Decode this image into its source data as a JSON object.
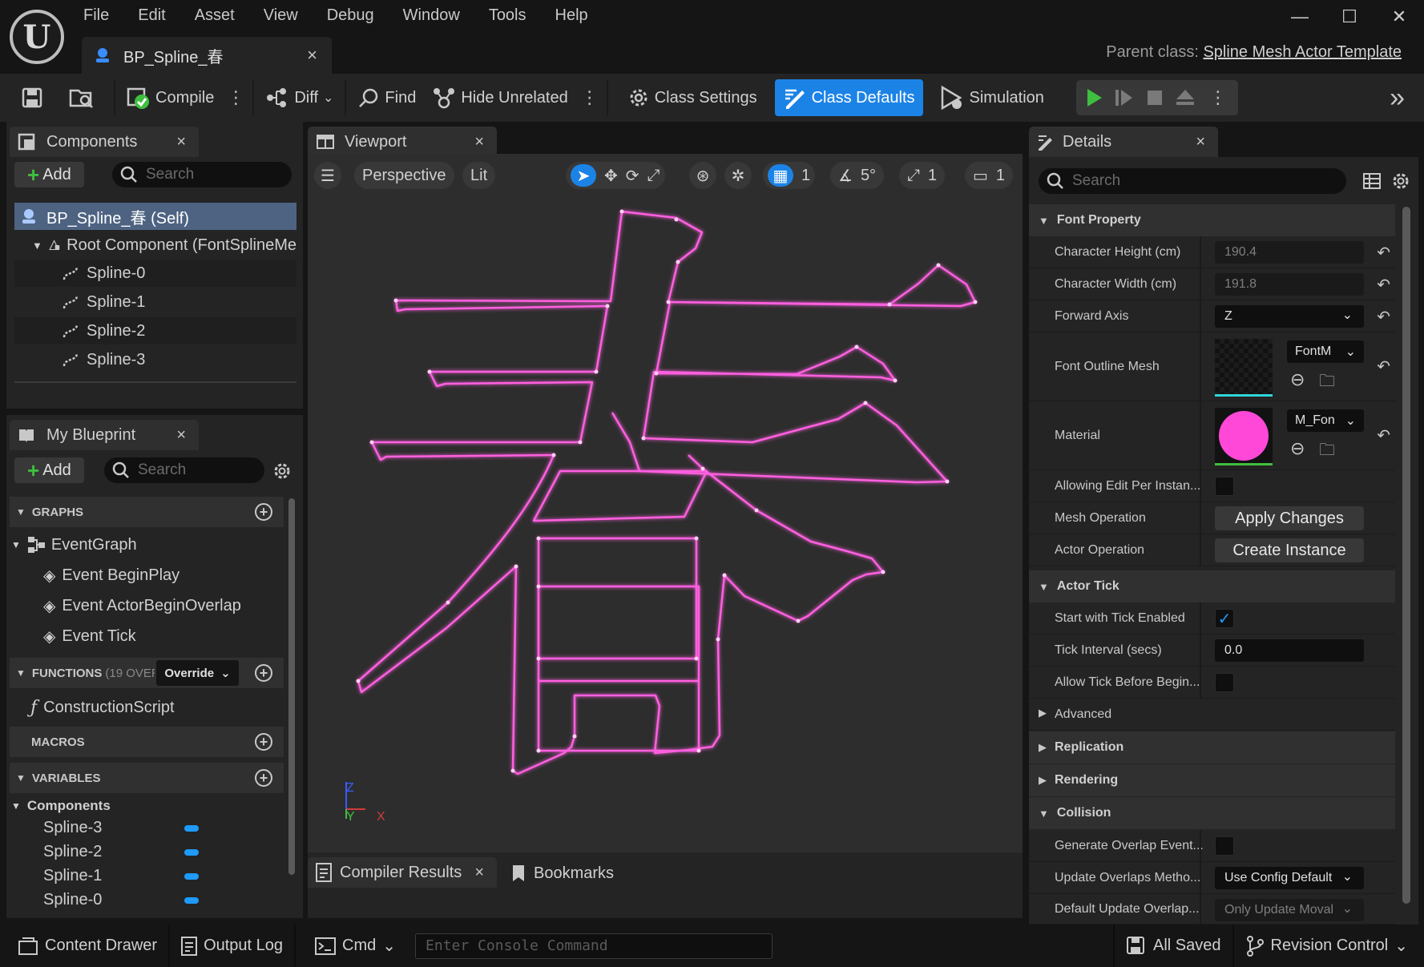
{
  "app": {
    "logo": "U"
  },
  "menu": [
    "File",
    "Edit",
    "Asset",
    "View",
    "Debug",
    "Window",
    "Tools",
    "Help"
  ],
  "document_tab": {
    "title": "BP_Spline_春",
    "close": "×"
  },
  "window_controls": {
    "minimize": "—",
    "maximize": "☐",
    "close": "✕"
  },
  "parent_class": {
    "label": "Parent class:",
    "value": "Spline Mesh Actor Template"
  },
  "toolbar": {
    "compile": "Compile",
    "diff": "Diff",
    "find": "Find",
    "hide_unrelated": "Hide Unrelated",
    "class_settings": "Class Settings",
    "class_defaults": "Class Defaults",
    "simulation": "Simulation",
    "overflow": "»"
  },
  "components_panel": {
    "tab": "Components",
    "add": "Add",
    "search_placeholder": "Search",
    "items": [
      {
        "label": "BP_Spline_春 (Self)"
      },
      {
        "label": "Root Component (FontSplineMe"
      },
      {
        "label": "Spline-0"
      },
      {
        "label": "Spline-1"
      },
      {
        "label": "Spline-2"
      },
      {
        "label": "Spline-3"
      }
    ]
  },
  "my_blueprint": {
    "tab": "My Blueprint",
    "add": "Add",
    "search_placeholder": "Search",
    "graphs_header": "GRAPHS",
    "event_graph": "EventGraph",
    "events": [
      "Event BeginPlay",
      "Event ActorBeginOverlap",
      "Event Tick"
    ],
    "functions_header": "FUNCTIONS",
    "functions_count": "(19 OVER",
    "override": "Override",
    "construction_script": "ConstructionScript",
    "macros_header": "MACROS",
    "variables_header": "VARIABLES",
    "components_group": "Components",
    "variables": [
      "Spline-3",
      "Spline-2",
      "Spline-1",
      "Spline-0"
    ],
    "variable_color": "#1e9bff"
  },
  "viewport": {
    "tab": "Viewport",
    "perspective": "Perspective",
    "lit": "Lit",
    "grid_value": "1",
    "angle_value": "5°",
    "scale_value": "1",
    "camera_value": "1",
    "spline_color": "#ff5fe0",
    "axis": {
      "z": "Z",
      "y": "Y",
      "x": "X"
    }
  },
  "bottom_tabs": {
    "compiler_results": "Compiler Results",
    "bookmarks": "Bookmarks"
  },
  "details": {
    "tab": "Details",
    "search_placeholder": "Search",
    "font_property": "Font Property",
    "character_height_label": "Character Height (cm)",
    "character_height": "190.4",
    "character_width_label": "Character Width (cm)",
    "character_width": "191.8",
    "forward_axis_label": "Forward Axis",
    "forward_axis": "Z",
    "font_outline_mesh_label": "Font Outline Mesh",
    "font_outline_mesh_value": "FontM",
    "material_label": "Material",
    "material_value": "M_Fon",
    "material_color": "#ff48d8",
    "allow_edit_label": "Allowing Edit Per Instan...",
    "mesh_operation_label": "Mesh Operation",
    "apply_changes": "Apply Changes",
    "actor_operation_label": "Actor Operation",
    "create_instance": "Create Instance",
    "actor_tick": "Actor Tick",
    "start_tick_label": "Start with Tick Enabled",
    "start_tick_checked": true,
    "tick_interval_label": "Tick Interval (secs)",
    "tick_interval": "0.0",
    "allow_tick_label": "Allow Tick Before Begin...",
    "advanced": "Advanced",
    "replication": "Replication",
    "rendering": "Rendering",
    "collision": "Collision",
    "gen_overlap_label": "Generate Overlap Event...",
    "update_overlaps_label": "Update Overlaps Metho...",
    "update_overlaps_value": "Use Config Default",
    "default_update_label": "Default Update Overlap...",
    "default_update_value": "Only Update Moval"
  },
  "statusbar": {
    "content_drawer": "Content Drawer",
    "output_log": "Output Log",
    "cmd": "Cmd",
    "console_placeholder": "Enter Console Command",
    "all_saved": "All Saved",
    "revision_control": "Revision Control"
  }
}
